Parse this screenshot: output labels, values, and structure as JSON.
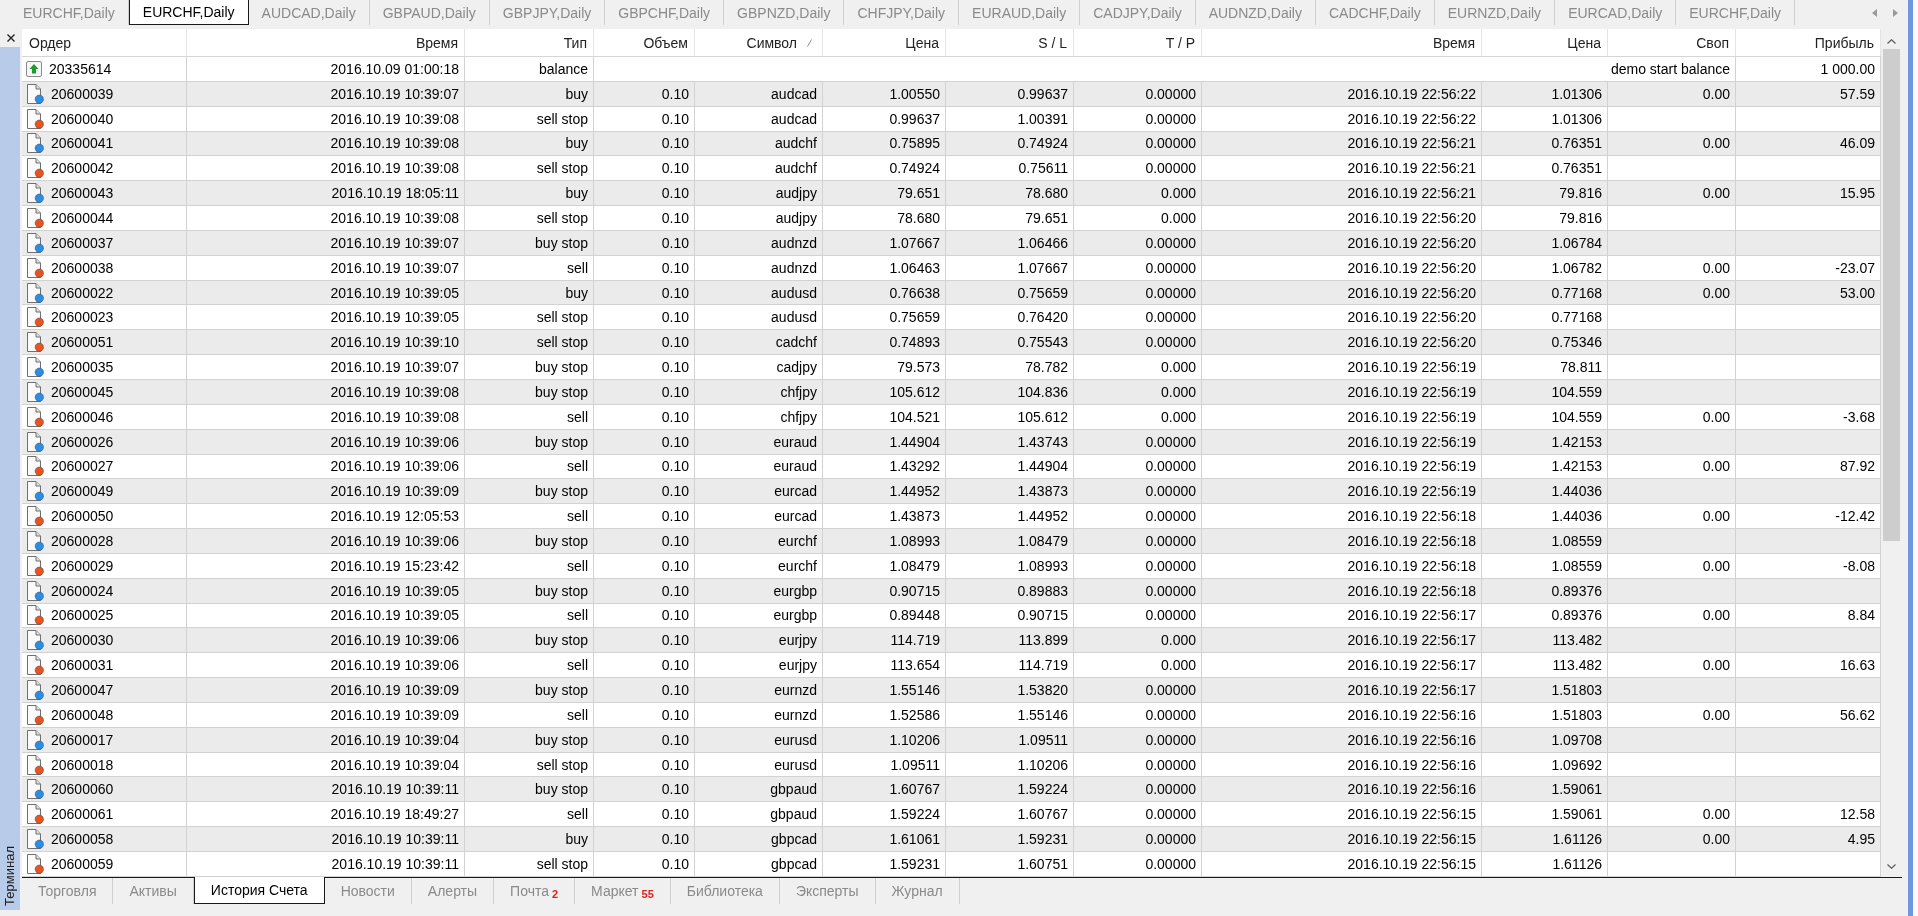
{
  "chart_tabs": [
    {
      "label": "EURCHF,Daily",
      "selected": false
    },
    {
      "label": "EURCHF,Daily",
      "selected": true
    },
    {
      "label": "AUDCAD,Daily",
      "selected": false
    },
    {
      "label": "GBPAUD,Daily",
      "selected": false
    },
    {
      "label": "GBPJPY,Daily",
      "selected": false
    },
    {
      "label": "GBPCHF,Daily",
      "selected": false
    },
    {
      "label": "GBPNZD,Daily",
      "selected": false
    },
    {
      "label": "CHFJPY,Daily",
      "selected": false
    },
    {
      "label": "EURAUD,Daily",
      "selected": false
    },
    {
      "label": "CADJPY,Daily",
      "selected": false
    },
    {
      "label": "AUDNZD,Daily",
      "selected": false
    },
    {
      "label": "CADCHF,Daily",
      "selected": false
    },
    {
      "label": "EURNZD,Daily",
      "selected": false
    },
    {
      "label": "EURCAD,Daily",
      "selected": false
    },
    {
      "label": "EURCHF,Daily",
      "selected": false
    }
  ],
  "terminal": {
    "title": "Терминал"
  },
  "table": {
    "columns": [
      {
        "label": "Ордер",
        "sorted": false
      },
      {
        "label": "Время",
        "sorted": false
      },
      {
        "label": "Тип",
        "sorted": false
      },
      {
        "label": "Объем",
        "sorted": false
      },
      {
        "label": "Символ",
        "sorted": true
      },
      {
        "label": "Цена",
        "sorted": false
      },
      {
        "label": "S / L",
        "sorted": false
      },
      {
        "label": "T / P",
        "sorted": false
      },
      {
        "label": "Время",
        "sorted": false
      },
      {
        "label": "Цена",
        "sorted": false
      },
      {
        "label": "Своп",
        "sorted": false
      },
      {
        "label": "Прибыль",
        "sorted": false
      }
    ],
    "rows": [
      {
        "kind": "balance",
        "order": "20335614",
        "time": "2016.10.09 01:00:18",
        "type": "balance",
        "comment": "demo start balance",
        "profit": "1 000.00"
      },
      {
        "kind": "buy",
        "order": "20600039",
        "time": "2016.10.19 10:39:07",
        "type": "buy",
        "volume": "0.10",
        "symbol": "audcad",
        "price": "1.00550",
        "sl": "0.99637",
        "tp": "0.00000",
        "close_time": "2016.10.19 22:56:22",
        "close_price": "1.01306",
        "swap": "0.00",
        "profit": "57.59"
      },
      {
        "kind": "sell",
        "order": "20600040",
        "time": "2016.10.19 10:39:08",
        "type": "sell stop",
        "volume": "0.10",
        "symbol": "audcad",
        "price": "0.99637",
        "sl": "1.00391",
        "tp": "0.00000",
        "close_time": "2016.10.19 22:56:22",
        "close_price": "1.01306"
      },
      {
        "kind": "buy",
        "order": "20600041",
        "time": "2016.10.19 10:39:08",
        "type": "buy",
        "volume": "0.10",
        "symbol": "audchf",
        "price": "0.75895",
        "sl": "0.74924",
        "tp": "0.00000",
        "close_time": "2016.10.19 22:56:21",
        "close_price": "0.76351",
        "swap": "0.00",
        "profit": "46.09"
      },
      {
        "kind": "sell",
        "order": "20600042",
        "time": "2016.10.19 10:39:08",
        "type": "sell stop",
        "volume": "0.10",
        "symbol": "audchf",
        "price": "0.74924",
        "sl": "0.75611",
        "tp": "0.00000",
        "close_time": "2016.10.19 22:56:21",
        "close_price": "0.76351"
      },
      {
        "kind": "buy",
        "order": "20600043",
        "time": "2016.10.19 18:05:11",
        "type": "buy",
        "volume": "0.10",
        "symbol": "audjpy",
        "price": "79.651",
        "sl": "78.680",
        "tp": "0.000",
        "close_time": "2016.10.19 22:56:21",
        "close_price": "79.816",
        "swap": "0.00",
        "profit": "15.95"
      },
      {
        "kind": "sell",
        "order": "20600044",
        "time": "2016.10.19 10:39:08",
        "type": "sell stop",
        "volume": "0.10",
        "symbol": "audjpy",
        "price": "78.680",
        "sl": "79.651",
        "tp": "0.000",
        "close_time": "2016.10.19 22:56:20",
        "close_price": "79.816"
      },
      {
        "kind": "buy",
        "order": "20600037",
        "time": "2016.10.19 10:39:07",
        "type": "buy stop",
        "volume": "0.10",
        "symbol": "audnzd",
        "price": "1.07667",
        "sl": "1.06466",
        "tp": "0.00000",
        "close_time": "2016.10.19 22:56:20",
        "close_price": "1.06784"
      },
      {
        "kind": "sell",
        "order": "20600038",
        "time": "2016.10.19 10:39:07",
        "type": "sell",
        "volume": "0.10",
        "symbol": "audnzd",
        "price": "1.06463",
        "sl": "1.07667",
        "tp": "0.00000",
        "close_time": "2016.10.19 22:56:20",
        "close_price": "1.06782",
        "swap": "0.00",
        "profit": "-23.07"
      },
      {
        "kind": "buy",
        "order": "20600022",
        "time": "2016.10.19 10:39:05",
        "type": "buy",
        "volume": "0.10",
        "symbol": "audusd",
        "price": "0.76638",
        "sl": "0.75659",
        "tp": "0.00000",
        "close_time": "2016.10.19 22:56:20",
        "close_price": "0.77168",
        "swap": "0.00",
        "profit": "53.00"
      },
      {
        "kind": "sell",
        "order": "20600023",
        "time": "2016.10.19 10:39:05",
        "type": "sell stop",
        "volume": "0.10",
        "symbol": "audusd",
        "price": "0.75659",
        "sl": "0.76420",
        "tp": "0.00000",
        "close_time": "2016.10.19 22:56:20",
        "close_price": "0.77168"
      },
      {
        "kind": "sell",
        "order": "20600051",
        "time": "2016.10.19 10:39:10",
        "type": "sell stop",
        "volume": "0.10",
        "symbol": "cadchf",
        "price": "0.74893",
        "sl": "0.75543",
        "tp": "0.00000",
        "close_time": "2016.10.19 22:56:20",
        "close_price": "0.75346"
      },
      {
        "kind": "buy",
        "order": "20600035",
        "time": "2016.10.19 10:39:07",
        "type": "buy stop",
        "volume": "0.10",
        "symbol": "cadjpy",
        "price": "79.573",
        "sl": "78.782",
        "tp": "0.000",
        "close_time": "2016.10.19 22:56:19",
        "close_price": "78.811"
      },
      {
        "kind": "buy",
        "order": "20600045",
        "time": "2016.10.19 10:39:08",
        "type": "buy stop",
        "volume": "0.10",
        "symbol": "chfjpy",
        "price": "105.612",
        "sl": "104.836",
        "tp": "0.000",
        "close_time": "2016.10.19 22:56:19",
        "close_price": "104.559"
      },
      {
        "kind": "sell",
        "order": "20600046",
        "time": "2016.10.19 10:39:08",
        "type": "sell",
        "volume": "0.10",
        "symbol": "chfjpy",
        "price": "104.521",
        "sl": "105.612",
        "tp": "0.000",
        "close_time": "2016.10.19 22:56:19",
        "close_price": "104.559",
        "swap": "0.00",
        "profit": "-3.68"
      },
      {
        "kind": "buy",
        "order": "20600026",
        "time": "2016.10.19 10:39:06",
        "type": "buy stop",
        "volume": "0.10",
        "symbol": "euraud",
        "price": "1.44904",
        "sl": "1.43743",
        "tp": "0.00000",
        "close_time": "2016.10.19 22:56:19",
        "close_price": "1.42153"
      },
      {
        "kind": "sell",
        "order": "20600027",
        "time": "2016.10.19 10:39:06",
        "type": "sell",
        "volume": "0.10",
        "symbol": "euraud",
        "price": "1.43292",
        "sl": "1.44904",
        "tp": "0.00000",
        "close_time": "2016.10.19 22:56:19",
        "close_price": "1.42153",
        "swap": "0.00",
        "profit": "87.92"
      },
      {
        "kind": "buy",
        "order": "20600049",
        "time": "2016.10.19 10:39:09",
        "type": "buy stop",
        "volume": "0.10",
        "symbol": "eurcad",
        "price": "1.44952",
        "sl": "1.43873",
        "tp": "0.00000",
        "close_time": "2016.10.19 22:56:19",
        "close_price": "1.44036"
      },
      {
        "kind": "sell",
        "order": "20600050",
        "time": "2016.10.19 12:05:53",
        "type": "sell",
        "volume": "0.10",
        "symbol": "eurcad",
        "price": "1.43873",
        "sl": "1.44952",
        "tp": "0.00000",
        "close_time": "2016.10.19 22:56:18",
        "close_price": "1.44036",
        "swap": "0.00",
        "profit": "-12.42"
      },
      {
        "kind": "buy",
        "order": "20600028",
        "time": "2016.10.19 10:39:06",
        "type": "buy stop",
        "volume": "0.10",
        "symbol": "eurchf",
        "price": "1.08993",
        "sl": "1.08479",
        "tp": "0.00000",
        "close_time": "2016.10.19 22:56:18",
        "close_price": "1.08559"
      },
      {
        "kind": "sell",
        "order": "20600029",
        "time": "2016.10.19 15:23:42",
        "type": "sell",
        "volume": "0.10",
        "symbol": "eurchf",
        "price": "1.08479",
        "sl": "1.08993",
        "tp": "0.00000",
        "close_time": "2016.10.19 22:56:18",
        "close_price": "1.08559",
        "swap": "0.00",
        "profit": "-8.08"
      },
      {
        "kind": "buy",
        "order": "20600024",
        "time": "2016.10.19 10:39:05",
        "type": "buy stop",
        "volume": "0.10",
        "symbol": "eurgbp",
        "price": "0.90715",
        "sl": "0.89883",
        "tp": "0.00000",
        "close_time": "2016.10.19 22:56:18",
        "close_price": "0.89376"
      },
      {
        "kind": "sell",
        "order": "20600025",
        "time": "2016.10.19 10:39:05",
        "type": "sell",
        "volume": "0.10",
        "symbol": "eurgbp",
        "price": "0.89448",
        "sl": "0.90715",
        "tp": "0.00000",
        "close_time": "2016.10.19 22:56:17",
        "close_price": "0.89376",
        "swap": "0.00",
        "profit": "8.84"
      },
      {
        "kind": "buy",
        "order": "20600030",
        "time": "2016.10.19 10:39:06",
        "type": "buy stop",
        "volume": "0.10",
        "symbol": "eurjpy",
        "price": "114.719",
        "sl": "113.899",
        "tp": "0.000",
        "close_time": "2016.10.19 22:56:17",
        "close_price": "113.482"
      },
      {
        "kind": "sell",
        "order": "20600031",
        "time": "2016.10.19 10:39:06",
        "type": "sell",
        "volume": "0.10",
        "symbol": "eurjpy",
        "price": "113.654",
        "sl": "114.719",
        "tp": "0.000",
        "close_time": "2016.10.19 22:56:17",
        "close_price": "113.482",
        "swap": "0.00",
        "profit": "16.63"
      },
      {
        "kind": "buy",
        "order": "20600047",
        "time": "2016.10.19 10:39:09",
        "type": "buy stop",
        "volume": "0.10",
        "symbol": "eurnzd",
        "price": "1.55146",
        "sl": "1.53820",
        "tp": "0.00000",
        "close_time": "2016.10.19 22:56:17",
        "close_price": "1.51803"
      },
      {
        "kind": "sell",
        "order": "20600048",
        "time": "2016.10.19 10:39:09",
        "type": "sell",
        "volume": "0.10",
        "symbol": "eurnzd",
        "price": "1.52586",
        "sl": "1.55146",
        "tp": "0.00000",
        "close_time": "2016.10.19 22:56:16",
        "close_price": "1.51803",
        "swap": "0.00",
        "profit": "56.62"
      },
      {
        "kind": "buy",
        "order": "20600017",
        "time": "2016.10.19 10:39:04",
        "type": "buy stop",
        "volume": "0.10",
        "symbol": "eurusd",
        "price": "1.10206",
        "sl": "1.09511",
        "tp": "0.00000",
        "close_time": "2016.10.19 22:56:16",
        "close_price": "1.09708"
      },
      {
        "kind": "sell",
        "order": "20600018",
        "time": "2016.10.19 10:39:04",
        "type": "sell stop",
        "volume": "0.10",
        "symbol": "eurusd",
        "price": "1.09511",
        "sl": "1.10206",
        "tp": "0.00000",
        "close_time": "2016.10.19 22:56:16",
        "close_price": "1.09692"
      },
      {
        "kind": "buy",
        "order": "20600060",
        "time": "2016.10.19 10:39:11",
        "type": "buy stop",
        "volume": "0.10",
        "symbol": "gbpaud",
        "price": "1.60767",
        "sl": "1.59224",
        "tp": "0.00000",
        "close_time": "2016.10.19 22:56:16",
        "close_price": "1.59061"
      },
      {
        "kind": "sell",
        "order": "20600061",
        "time": "2016.10.19 18:49:27",
        "type": "sell",
        "volume": "0.10",
        "symbol": "gbpaud",
        "price": "1.59224",
        "sl": "1.60767",
        "tp": "0.00000",
        "close_time": "2016.10.19 22:56:15",
        "close_price": "1.59061",
        "swap": "0.00",
        "profit": "12.58"
      },
      {
        "kind": "buy",
        "order": "20600058",
        "time": "2016.10.19 10:39:11",
        "type": "buy",
        "volume": "0.10",
        "symbol": "gbpcad",
        "price": "1.61061",
        "sl": "1.59231",
        "tp": "0.00000",
        "close_time": "2016.10.19 22:56:15",
        "close_price": "1.61126",
        "swap": "0.00",
        "profit": "4.95"
      },
      {
        "kind": "sell",
        "order": "20600059",
        "time": "2016.10.19 10:39:11",
        "type": "sell stop",
        "volume": "0.10",
        "symbol": "gbpcad",
        "price": "1.59231",
        "sl": "1.60751",
        "tp": "0.00000",
        "close_time": "2016.10.19 22:56:15",
        "close_price": "1.61126"
      }
    ]
  },
  "bottom_tabs": [
    {
      "label": "Торговля",
      "selected": false
    },
    {
      "label": "Активы",
      "selected": false
    },
    {
      "label": "История Счета",
      "selected": true
    },
    {
      "label": "Новости",
      "selected": false
    },
    {
      "label": "Алерты",
      "selected": false
    },
    {
      "label": "Почта",
      "badge": "2",
      "selected": false
    },
    {
      "label": "Маркет",
      "badge": "55",
      "selected": false
    },
    {
      "label": "Библиотека",
      "selected": false
    },
    {
      "label": "Эксперты",
      "selected": false
    },
    {
      "label": "Журнал",
      "selected": false
    }
  ]
}
